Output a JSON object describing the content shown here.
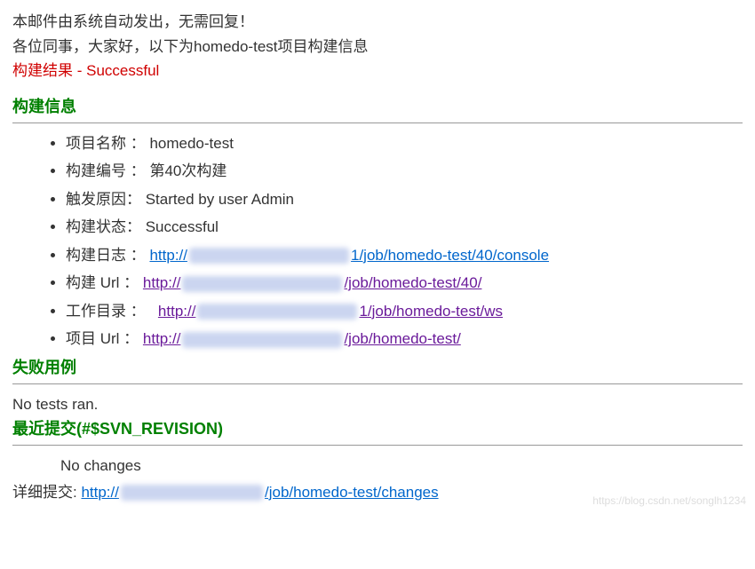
{
  "header": {
    "line1": "本邮件由系统自动发出，无需回复！",
    "line2": "各位同事，大家好，以下为homedo-test项目构建信息",
    "result": "构建结果 - Successful"
  },
  "section_build_info": {
    "title": "构建信息",
    "items": {
      "project_name_label": "项目名称 ：",
      "project_name_value": "  homedo-test",
      "build_number_label": "构建编号 ：",
      "build_number_value": "  第40次构建",
      "trigger_label": "触发原因：",
      "trigger_value": "  Started by user Admin",
      "status_label": "构建状态：",
      "status_value": "  Successful",
      "log_label": "构建日志 ：",
      "log_url_prefix": "http://",
      "log_url_suffix": "1/job/homedo-test/40/console",
      "build_url_label": "构建 Url ：",
      "build_url_prefix": "http://",
      "build_url_suffix": "/job/homedo-test/40/",
      "workdir_label": "工作目录 ：",
      "workdir_url_prefix": "http://",
      "workdir_url_suffix": "1/job/homedo-test/ws",
      "project_url_label": "项目 Url ：",
      "project_url_prefix": "http://",
      "project_url_suffix": "/job/homedo-test/"
    }
  },
  "section_failed": {
    "title": "失败用例",
    "no_tests": "No tests ran."
  },
  "section_commit": {
    "title": "最近提交(#$SVN_REVISION)",
    "no_changes": "No changes",
    "detail_label": "详细提交: ",
    "detail_url_prefix": "http://",
    "detail_url_suffix": "/job/homedo-test/changes"
  },
  "watermark": "https://blog.csdn.net/songlh1234"
}
